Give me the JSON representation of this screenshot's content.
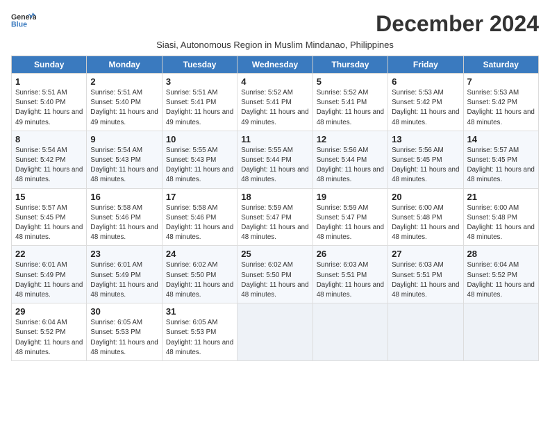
{
  "header": {
    "logo_general": "General",
    "logo_blue": "Blue",
    "month_title": "December 2024",
    "subtitle": "Siasi, Autonomous Region in Muslim Mindanao, Philippines"
  },
  "weekdays": [
    "Sunday",
    "Monday",
    "Tuesday",
    "Wednesday",
    "Thursday",
    "Friday",
    "Saturday"
  ],
  "weeks": [
    [
      {
        "day": "1",
        "sunrise": "5:51 AM",
        "sunset": "5:40 PM",
        "daylight": "11 hours and 49 minutes."
      },
      {
        "day": "2",
        "sunrise": "5:51 AM",
        "sunset": "5:40 PM",
        "daylight": "11 hours and 49 minutes."
      },
      {
        "day": "3",
        "sunrise": "5:51 AM",
        "sunset": "5:41 PM",
        "daylight": "11 hours and 49 minutes."
      },
      {
        "day": "4",
        "sunrise": "5:52 AM",
        "sunset": "5:41 PM",
        "daylight": "11 hours and 49 minutes."
      },
      {
        "day": "5",
        "sunrise": "5:52 AM",
        "sunset": "5:41 PM",
        "daylight": "11 hours and 48 minutes."
      },
      {
        "day": "6",
        "sunrise": "5:53 AM",
        "sunset": "5:42 PM",
        "daylight": "11 hours and 48 minutes."
      },
      {
        "day": "7",
        "sunrise": "5:53 AM",
        "sunset": "5:42 PM",
        "daylight": "11 hours and 48 minutes."
      }
    ],
    [
      {
        "day": "8",
        "sunrise": "5:54 AM",
        "sunset": "5:42 PM",
        "daylight": "11 hours and 48 minutes."
      },
      {
        "day": "9",
        "sunrise": "5:54 AM",
        "sunset": "5:43 PM",
        "daylight": "11 hours and 48 minutes."
      },
      {
        "day": "10",
        "sunrise": "5:55 AM",
        "sunset": "5:43 PM",
        "daylight": "11 hours and 48 minutes."
      },
      {
        "day": "11",
        "sunrise": "5:55 AM",
        "sunset": "5:44 PM",
        "daylight": "11 hours and 48 minutes."
      },
      {
        "day": "12",
        "sunrise": "5:56 AM",
        "sunset": "5:44 PM",
        "daylight": "11 hours and 48 minutes."
      },
      {
        "day": "13",
        "sunrise": "5:56 AM",
        "sunset": "5:45 PM",
        "daylight": "11 hours and 48 minutes."
      },
      {
        "day": "14",
        "sunrise": "5:57 AM",
        "sunset": "5:45 PM",
        "daylight": "11 hours and 48 minutes."
      }
    ],
    [
      {
        "day": "15",
        "sunrise": "5:57 AM",
        "sunset": "5:45 PM",
        "daylight": "11 hours and 48 minutes."
      },
      {
        "day": "16",
        "sunrise": "5:58 AM",
        "sunset": "5:46 PM",
        "daylight": "11 hours and 48 minutes."
      },
      {
        "day": "17",
        "sunrise": "5:58 AM",
        "sunset": "5:46 PM",
        "daylight": "11 hours and 48 minutes."
      },
      {
        "day": "18",
        "sunrise": "5:59 AM",
        "sunset": "5:47 PM",
        "daylight": "11 hours and 48 minutes."
      },
      {
        "day": "19",
        "sunrise": "5:59 AM",
        "sunset": "5:47 PM",
        "daylight": "11 hours and 48 minutes."
      },
      {
        "day": "20",
        "sunrise": "6:00 AM",
        "sunset": "5:48 PM",
        "daylight": "11 hours and 48 minutes."
      },
      {
        "day": "21",
        "sunrise": "6:00 AM",
        "sunset": "5:48 PM",
        "daylight": "11 hours and 48 minutes."
      }
    ],
    [
      {
        "day": "22",
        "sunrise": "6:01 AM",
        "sunset": "5:49 PM",
        "daylight": "11 hours and 48 minutes."
      },
      {
        "day": "23",
        "sunrise": "6:01 AM",
        "sunset": "5:49 PM",
        "daylight": "11 hours and 48 minutes."
      },
      {
        "day": "24",
        "sunrise": "6:02 AM",
        "sunset": "5:50 PM",
        "daylight": "11 hours and 48 minutes."
      },
      {
        "day": "25",
        "sunrise": "6:02 AM",
        "sunset": "5:50 PM",
        "daylight": "11 hours and 48 minutes."
      },
      {
        "day": "26",
        "sunrise": "6:03 AM",
        "sunset": "5:51 PM",
        "daylight": "11 hours and 48 minutes."
      },
      {
        "day": "27",
        "sunrise": "6:03 AM",
        "sunset": "5:51 PM",
        "daylight": "11 hours and 48 minutes."
      },
      {
        "day": "28",
        "sunrise": "6:04 AM",
        "sunset": "5:52 PM",
        "daylight": "11 hours and 48 minutes."
      }
    ],
    [
      {
        "day": "29",
        "sunrise": "6:04 AM",
        "sunset": "5:52 PM",
        "daylight": "11 hours and 48 minutes."
      },
      {
        "day": "30",
        "sunrise": "6:05 AM",
        "sunset": "5:53 PM",
        "daylight": "11 hours and 48 minutes."
      },
      {
        "day": "31",
        "sunrise": "6:05 AM",
        "sunset": "5:53 PM",
        "daylight": "11 hours and 48 minutes."
      },
      null,
      null,
      null,
      null
    ]
  ]
}
